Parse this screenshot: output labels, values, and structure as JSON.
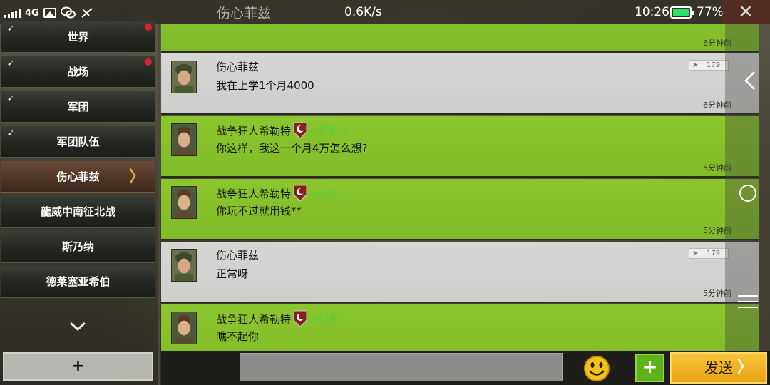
{
  "status_bar": {
    "network": "4G",
    "title": "伤心菲兹",
    "speed": "0.6K/s",
    "time": "10:26",
    "battery": "77%",
    "battery_level": 0.77,
    "close_glyph": "✕"
  },
  "sidebar": {
    "channels": [
      {
        "label": "世界",
        "pinned": true,
        "unread": true
      },
      {
        "label": "战场",
        "pinned": true,
        "unread": true
      },
      {
        "label": "军团",
        "pinned": true,
        "unread": false
      },
      {
        "label": "军团队伍",
        "pinned": true,
        "unread": false
      },
      {
        "label": "伤心菲兹",
        "pinned": false,
        "unread": false,
        "active": true,
        "arrow": "〉"
      },
      {
        "label": "龍威中南征北战",
        "pinned": false,
        "unread": false
      },
      {
        "label": "斯乃纳",
        "pinned": false,
        "unread": false
      },
      {
        "label": "德莱塞亚希伯",
        "pinned": false,
        "unread": false
      }
    ],
    "add_label": "+"
  },
  "messages": [
    {
      "type": "green",
      "sender": "",
      "text": "",
      "time": "6分钟前"
    },
    {
      "type": "grey",
      "sender": "伤心菲兹",
      "text": "我在上学1个月4000",
      "time": "6分钟前",
      "report_count": "179"
    },
    {
      "type": "green",
      "sender": "战争狂人希勒特",
      "guild": "<幻月>",
      "text": "你这样，我这一个月4万怎么想?",
      "time": "5分钟前"
    },
    {
      "type": "green",
      "sender": "战争狂人希勒特",
      "guild": "<幻月>",
      "text": "你玩不过就用钱**",
      "time": "5分钟前"
    },
    {
      "type": "grey",
      "sender": "伤心菲兹",
      "text": "正常呀",
      "time": "5分钟前",
      "report_count": "179"
    },
    {
      "type": "green",
      "sender": "战争狂人希勒特",
      "guild": "<幻月>",
      "text": "瞧不起你",
      "time": ""
    }
  ],
  "input_bar": {
    "placeholder": "",
    "plus_label": "+",
    "send_label": "发送",
    "send_chevron": "〉"
  },
  "colors": {
    "green_message": "#86c22c",
    "grey_message": "#d2d2d0",
    "send_button": "#f2b52a",
    "guild_text": "#4fd040"
  }
}
